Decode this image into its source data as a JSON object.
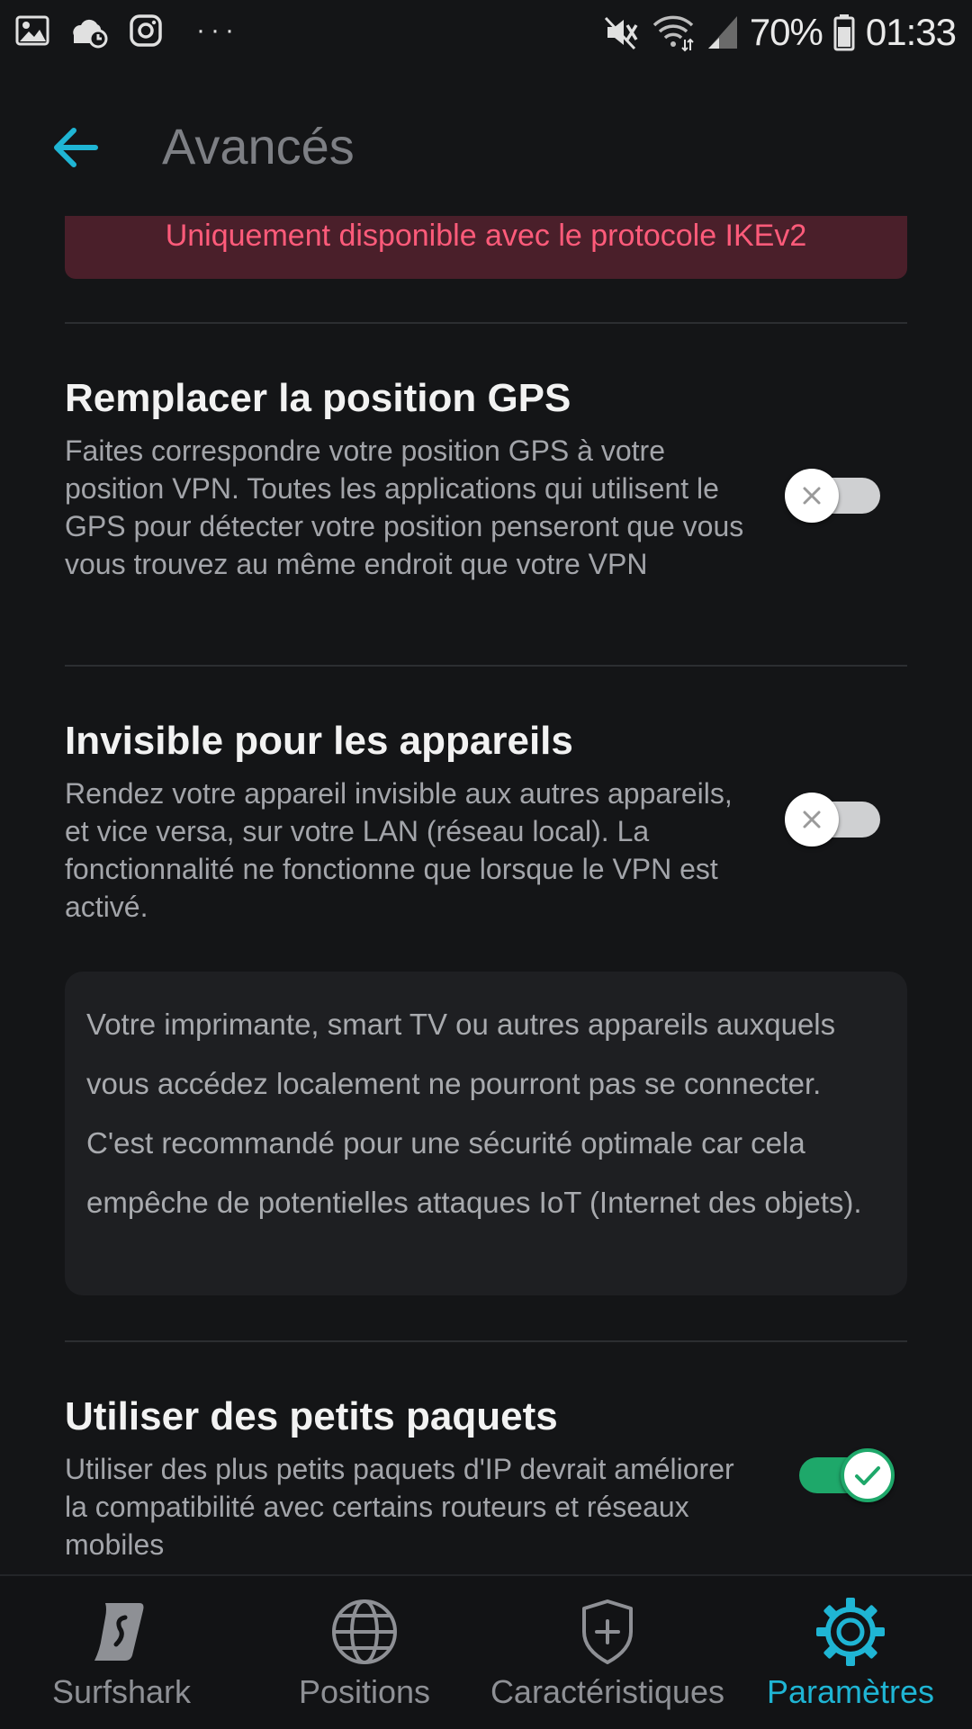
{
  "status_bar": {
    "battery_percent": "70%",
    "time": "01:33",
    "more_dots": "···"
  },
  "header": {
    "title": "Avancés"
  },
  "warning_banner": {
    "text": "Uniquement disponible avec le protocole IKEv2"
  },
  "settings": [
    {
      "title": "Remplacer la position GPS",
      "description": "Faites correspondre votre position GPS à votre position VPN. Toutes les applications qui utilisent le GPS pour détecter votre position penseront que vous vous trouvez au même endroit que votre VPN",
      "enabled": false
    },
    {
      "title": "Invisible pour les appareils",
      "description": "Rendez votre appareil invisible aux autres appareils, et vice versa, sur votre LAN (réseau local). La fonctionnalité ne fonctionne que lorsque le VPN est activé.",
      "enabled": false,
      "info": "Votre imprimante, smart TV ou autres appareils auxquels vous accédez localement ne pourront pas se connecter. C'est recommandé pour une sécurité optimale car cela empêche de potentielles attaques IoT (Internet des objets)."
    },
    {
      "title": "Utiliser des petits paquets",
      "description": "Utiliser des plus petits paquets d'IP devrait améliorer la compatibilité avec certains routeurs et réseaux mobiles",
      "enabled": true
    }
  ],
  "bottom_nav": {
    "items": [
      {
        "label": "Surfshark",
        "icon": "surfshark-logo-icon",
        "active": false
      },
      {
        "label": "Positions",
        "icon": "globe-icon",
        "active": false
      },
      {
        "label": "Caractéristiques",
        "icon": "shield-plus-icon",
        "active": false
      },
      {
        "label": "Paramètres",
        "icon": "gear-icon",
        "active": true
      }
    ]
  },
  "colors": {
    "background": "#141517",
    "accent": "#1fb5d4",
    "toggle_on": "#1ea86a",
    "warning_text": "#ff5b7a",
    "warning_bg": "#4a1f2a"
  }
}
